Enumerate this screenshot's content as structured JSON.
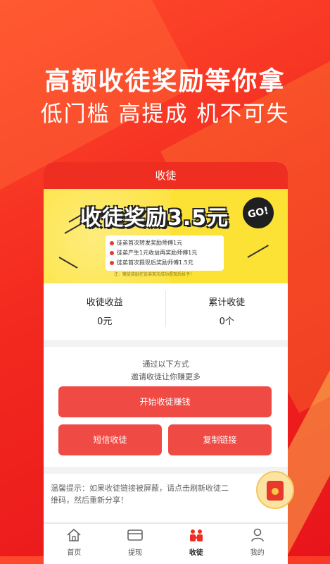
{
  "headline": {
    "line1": "高额收徒奖励等你拿",
    "line2": "低门槛 高提成 机不可失"
  },
  "app": {
    "title": "收徒"
  },
  "banner": {
    "title": "收徒奖励3.5元",
    "badge": "GO!",
    "rules": [
      "徒弟首次转发奖励师傅1元",
      "徒弟产生1元收益再奖励师傅1元",
      "徒弟首次提现后奖励师傅1.5元"
    ],
    "note": "注：徽徒奖励在徒弟首次成功提现后给予！"
  },
  "stats": {
    "income_label": "收徒收益",
    "income_value": "0元",
    "count_label": "累计收徒",
    "count_value": "0个"
  },
  "invite": {
    "line1": "通过以下方式",
    "line2": "邀请收徒让你赚更多",
    "start_button": "开始收徒赚钱",
    "sms_button": "短信收徒",
    "copy_button": "复制链接"
  },
  "tip": {
    "line1": "温馨提示：如果收徒链接被屏蔽，请点击刷新收徒二",
    "line2": "维码，然后重新分享！"
  },
  "tabs": [
    {
      "label": "首页",
      "icon": "home-icon"
    },
    {
      "label": "提现",
      "icon": "wallet-icon"
    },
    {
      "label": "收徒",
      "icon": "apprentice-icon"
    },
    {
      "label": "我的",
      "icon": "user-icon"
    }
  ],
  "colors": {
    "accent": "#ef2e22",
    "button": "#f04a45",
    "banner": "#fde236"
  }
}
